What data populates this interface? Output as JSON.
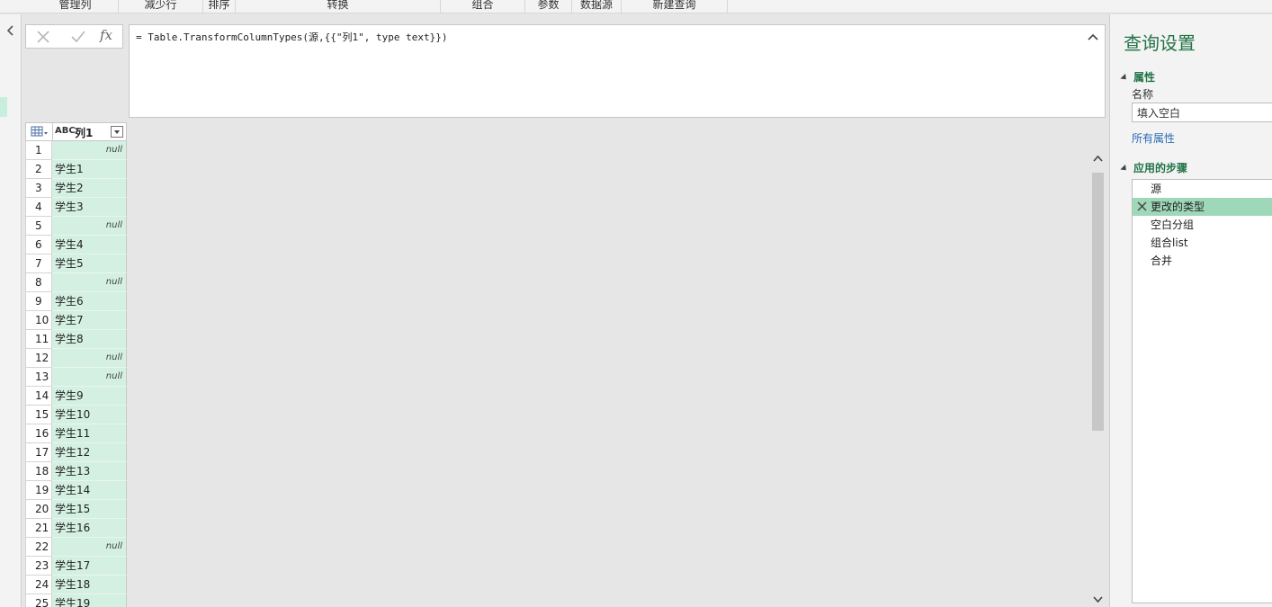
{
  "ribbon": {
    "groups": [
      "管理列",
      "减少行",
      "排序",
      "转换",
      "组合",
      "参数",
      "数据源",
      "新建查询"
    ]
  },
  "formula_bar": {
    "fx_label": "fx",
    "formula": "= Table.TransformColumnTypes(源,{{\"列1\", type text}})"
  },
  "grid": {
    "column": {
      "type_icon": "ABC",
      "name": "列1"
    },
    "rows": [
      {
        "index": "1",
        "value": "null"
      },
      {
        "index": "2",
        "value": "学生1"
      },
      {
        "index": "3",
        "value": "学生2"
      },
      {
        "index": "4",
        "value": "学生3"
      },
      {
        "index": "5",
        "value": "null"
      },
      {
        "index": "6",
        "value": "学生4"
      },
      {
        "index": "7",
        "value": "学生5"
      },
      {
        "index": "8",
        "value": "null"
      },
      {
        "index": "9",
        "value": "学生6"
      },
      {
        "index": "10",
        "value": "学生7"
      },
      {
        "index": "11",
        "value": "学生8"
      },
      {
        "index": "12",
        "value": "null"
      },
      {
        "index": "13",
        "value": "null"
      },
      {
        "index": "14",
        "value": "学生9"
      },
      {
        "index": "15",
        "value": "学生10"
      },
      {
        "index": "16",
        "value": "学生11"
      },
      {
        "index": "17",
        "value": "学生12"
      },
      {
        "index": "18",
        "value": "学生13"
      },
      {
        "index": "19",
        "value": "学生14"
      },
      {
        "index": "20",
        "value": "学生15"
      },
      {
        "index": "21",
        "value": "学生16"
      },
      {
        "index": "22",
        "value": "null"
      },
      {
        "index": "23",
        "value": "学生17"
      },
      {
        "index": "24",
        "value": "学生18"
      },
      {
        "index": "25",
        "value": "学生19"
      }
    ]
  },
  "settings": {
    "title": "查询设置",
    "properties_header": "属性",
    "name_label": "名称",
    "name_value": "填入空白",
    "all_properties_link": "所有属性",
    "steps_header": "应用的步骤",
    "steps": [
      {
        "label": "源",
        "selected": false
      },
      {
        "label": "更改的类型",
        "selected": true
      },
      {
        "label": "空白分组",
        "selected": false
      },
      {
        "label": "组合list",
        "selected": false
      },
      {
        "label": "合并",
        "selected": false
      }
    ]
  },
  "colors": {
    "accent_green": "#217346",
    "cell_green": "#d4f0e2",
    "selected_step": "#9fd7b9",
    "link_blue": "#2b6cb5"
  },
  "icons": {
    "cancel": "close-icon",
    "commit": "check-icon",
    "collapse_formula": "chevron-up-icon",
    "collapse_nav": "chevron-left-icon",
    "table_menu": "table-icon",
    "filter": "dropdown-icon",
    "delete_step": "close-icon"
  }
}
